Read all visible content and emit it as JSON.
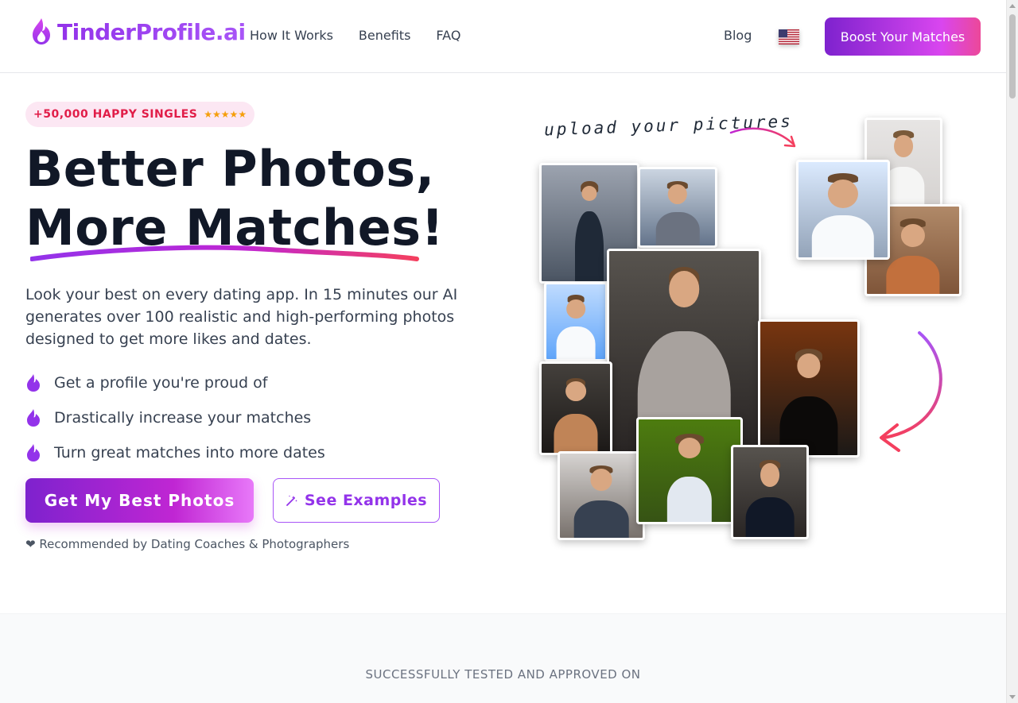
{
  "brand": {
    "name": "TinderProfile.ai"
  },
  "nav": {
    "items": [
      {
        "label": "How It Works"
      },
      {
        "label": "Benefits"
      },
      {
        "label": "FAQ"
      }
    ],
    "blog": "Blog",
    "language_flag": "us-flag-icon",
    "boost_label": "Boost Your Matches"
  },
  "hero": {
    "badge": {
      "text": "+50,000 HAPPY SINGLES",
      "stars": "★★★★★"
    },
    "headline_line1": "Better Photos,",
    "headline_line2": "More Matches!",
    "description": "Look your best on every dating app. In 15 minutes our AI generates over 100 realistic and high-performing photos designed to get more likes and dates.",
    "bullets": [
      {
        "text": "Get a profile you're proud of"
      },
      {
        "text": "Drastically increase your matches"
      },
      {
        "text": "Turn great matches into more dates"
      }
    ],
    "primary_cta": "Get My Best Photos",
    "secondary_cta": "See Examples",
    "recommended": "❤ Recommended by Dating Coaches & Photographers"
  },
  "collage": {
    "upload_label": "upload your pictures"
  },
  "trust": {
    "title": "SUCCESSFULLY TESTED AND APPROVED ON"
  },
  "colors": {
    "brand_purple": "#9333ea",
    "brand_pink": "#ec4899",
    "badge_bg": "#fce7f3",
    "badge_text": "#e11d48",
    "star": "#f59e0b"
  }
}
